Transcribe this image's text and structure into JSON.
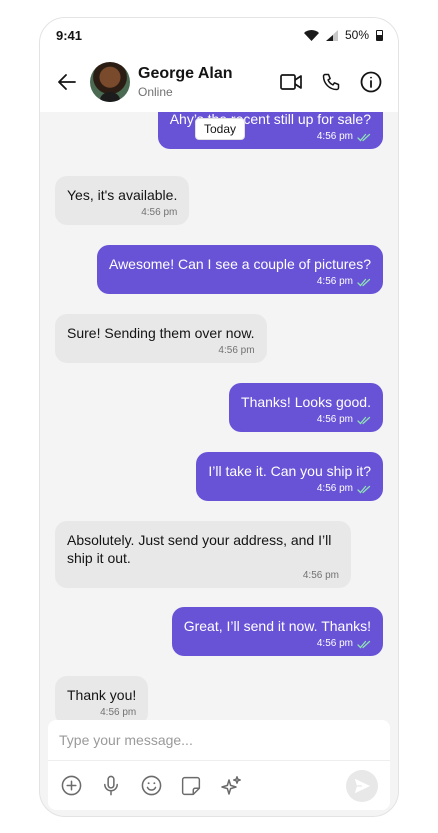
{
  "status_bar": {
    "time": "9:41",
    "battery": "50%"
  },
  "header": {
    "name": "George Alan",
    "presence": "Online"
  },
  "chat": {
    "date_separator": "Today",
    "messages": [
      {
        "direction": "out",
        "text": "Ahy’s the recent still up for sale?",
        "time": "4:56 pm"
      },
      {
        "direction": "in",
        "text": "Yes, it's available.",
        "time": "4:56 pm"
      },
      {
        "direction": "out",
        "text": "Awesome! Can I see a couple of pictures?",
        "time": "4:56 pm"
      },
      {
        "direction": "in",
        "text": "Sure! Sending them over now.",
        "time": "4:56 pm"
      },
      {
        "direction": "out",
        "text": "Thanks! Looks good.",
        "time": "4:56 pm"
      },
      {
        "direction": "out",
        "text": "I’ll take it. Can you ship it?",
        "time": "4:56 pm"
      },
      {
        "direction": "in",
        "text": "Absolutely. Just send your address, and I’ll ship it out.",
        "time": "4:56 pm"
      },
      {
        "direction": "out",
        "text": "Great, I’ll send it now. Thanks!",
        "time": "4:56 pm"
      },
      {
        "direction": "in",
        "text": "Thank you!",
        "time": "4:56 pm"
      }
    ]
  },
  "composer": {
    "placeholder": "Type your message..."
  },
  "colors": {
    "accent": "#6852d6",
    "incoming_bubble": "#e8e8e8",
    "background": "#f4f4f4"
  }
}
